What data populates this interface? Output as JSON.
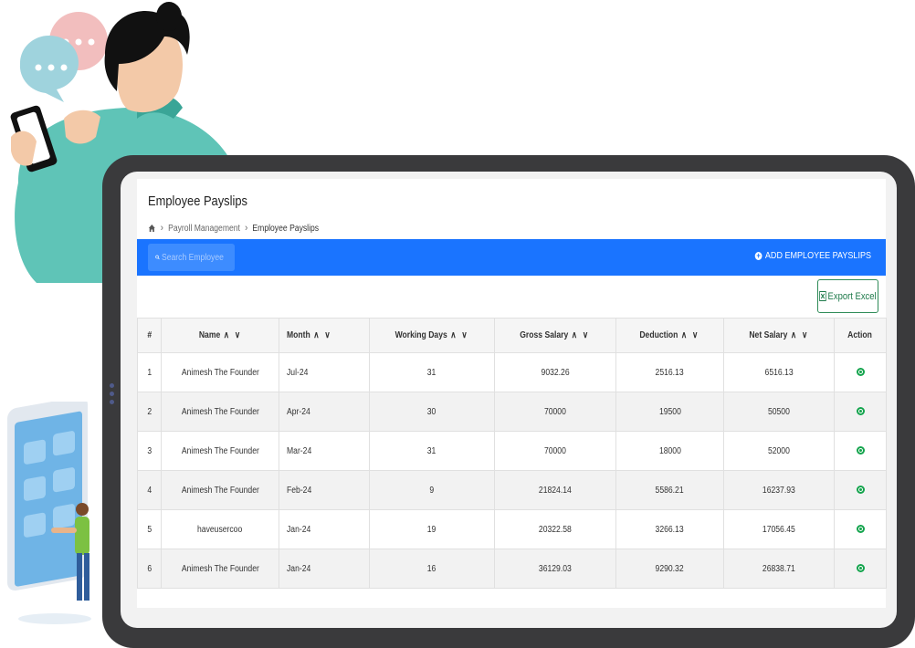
{
  "page": {
    "title": "Employee Payslips",
    "breadcrumb": [
      "Payroll Management",
      "Employee Payslips"
    ]
  },
  "toolbar": {
    "search_placeholder": "Search Employee Pays",
    "add_label": "ADD EMPLOYEE PAYSLIPS",
    "export_label": "Export Excel"
  },
  "table": {
    "headers": [
      "#",
      "Name",
      "Month",
      "Working Days",
      "Gross Salary",
      "Deduction",
      "Net Salary",
      "Action"
    ],
    "rows": [
      {
        "no": "1",
        "name": "Animesh The Founder",
        "month": "Jul-24",
        "days": "31",
        "gross": "9032.26",
        "deduction": "2516.13",
        "net": "6516.13"
      },
      {
        "no": "2",
        "name": "Animesh The Founder",
        "month": "Apr-24",
        "days": "30",
        "gross": "70000",
        "deduction": "19500",
        "net": "50500"
      },
      {
        "no": "3",
        "name": "Animesh The Founder",
        "month": "Mar-24",
        "days": "31",
        "gross": "70000",
        "deduction": "18000",
        "net": "52000"
      },
      {
        "no": "4",
        "name": "Animesh The Founder",
        "month": "Feb-24",
        "days": "9",
        "gross": "21824.14",
        "deduction": "5586.21",
        "net": "16237.93"
      },
      {
        "no": "5",
        "name": "haveusercoo",
        "month": "Jan-24",
        "days": "19",
        "gross": "20322.58",
        "deduction": "3266.13",
        "net": "17056.45"
      },
      {
        "no": "6",
        "name": "Animesh The Founder",
        "month": "Jan-24",
        "days": "16",
        "gross": "36129.03",
        "deduction": "9290.32",
        "net": "26838.71"
      }
    ]
  },
  "colors": {
    "accent": "#1a74ff",
    "action": "#14a44d"
  }
}
